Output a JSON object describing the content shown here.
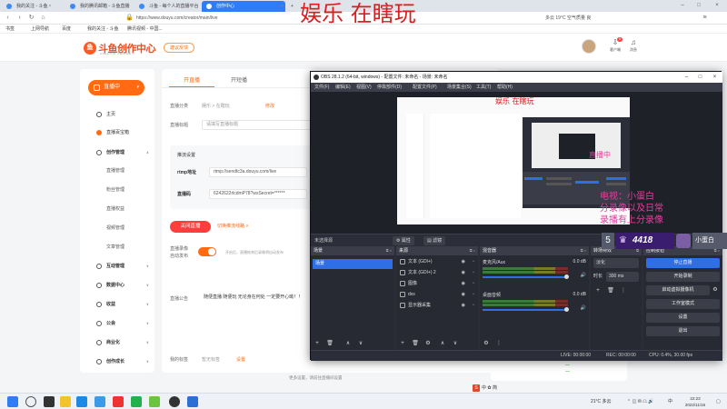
{
  "browser": {
    "tabs": [
      {
        "label": "我的关注 - 斗鱼"
      },
      {
        "label": "我的腾讯邮箱 - 斗鱼直播"
      },
      {
        "label": "斗鱼 - 每个人的直播平台"
      },
      {
        "label": "创作中心"
      }
    ],
    "url": "https://www.douyu.com/creator/main/live",
    "weather": "多云 19°C 空气质量 良",
    "favorites": [
      "书签",
      "上网导航",
      "百度",
      "我的关注 - 斗鱼",
      "腾讯视频 - 中国..."
    ],
    "overlay_title": "娱乐 在瞎玩"
  },
  "header": {
    "logo_text": "斗鱼创作中心",
    "logo_sub": "CREATOR CENTER",
    "pill": "建议反馈",
    "icons": [
      {
        "label": "客户端",
        "badge": "5"
      },
      {
        "label": "消息",
        "badge": ""
      }
    ]
  },
  "sidebar": {
    "live_button": "直播中",
    "items": [
      {
        "label": "主页",
        "caret": ""
      },
      {
        "label": "直播百宝箱",
        "caret": ""
      },
      {
        "label": "创作管理",
        "caret": "∧"
      },
      {
        "label": "互动管理",
        "caret": "∨"
      },
      {
        "label": "数据中心",
        "caret": "∨"
      },
      {
        "label": "收益",
        "caret": "∨"
      },
      {
        "label": "公会",
        "caret": "∨"
      },
      {
        "label": "商业化",
        "caret": "∨"
      },
      {
        "label": "创作成长",
        "caret": "∨"
      }
    ],
    "sub_items": [
      "直播管理",
      "粉丝管理",
      "直播权益",
      "视频管理",
      "文章管理"
    ]
  },
  "main": {
    "tabs": [
      "开直播",
      "开短播"
    ],
    "fields": {
      "category_label": "直播分类",
      "category_value": "娱乐 > 在瞎玩",
      "edit": "修改",
      "title_label": "直播标题",
      "title_value": "请填写直播标题",
      "push_title": "推流设置",
      "rtmp_label": "rtmp地址",
      "rtmp_value": "rtmp://sendtc3a.douyu.com/live",
      "code_label": "直播码",
      "code_value": "6242622rlcdmP78?wsSecret=******"
    },
    "close_live": "关闭直播",
    "switch_link": "切换推流线路 >",
    "record_label": "直播录像",
    "record_label2": "自动发布",
    "record_desc": "开启后，直播结束后录像将自动发布",
    "notice_label": "直播公告",
    "notice_text": "随便直播 随便玩 无论身在何处 一定要开心呦！！",
    "tags_label": "我的标签",
    "tags_value": "暂无标签",
    "tags_edit": "设置",
    "footer": "更多设置，请前往直播间设置",
    "right_numbers": [
      "—",
      "—"
    ]
  },
  "obs": {
    "title": "OBS 28.1.2 (64-bit, windows) - 配置文件: 未命名 - 场景: 未命名",
    "menu": [
      "文件(F)",
      "编辑(E)",
      "视图(V)",
      "停靠部件(D)",
      "配置文件(P)",
      "场景集合(S)",
      "工具(T)",
      "帮助(H)"
    ],
    "preview_overlay": "娱乐 在瞎玩",
    "scene_bar": {
      "no_source": "未选择源",
      "props": "属性",
      "filters": "滤镜"
    },
    "docks": {
      "scenes": {
        "title": "场景",
        "items": [
          "场景"
        ]
      },
      "sources": {
        "title": "来源",
        "items": [
          "文本 (GDI+)",
          "文本 (GDI+) 2",
          "图像",
          "dxs",
          "显示器采集"
        ]
      },
      "mixer": {
        "title": "混音器",
        "channels": [
          {
            "name": "麦克风/Aux",
            "db": "0.0 dB"
          },
          {
            "name": "桌面音频",
            "db": "0.0 dB"
          }
        ]
      },
      "transitions": {
        "title": "转场特效",
        "type": "淡化",
        "duration_label": "时长",
        "duration": "300 ms"
      },
      "controls": {
        "title": "控制按钮",
        "buttons": [
          "停止直播",
          "开始录制",
          "启动虚拟摄像机",
          "工作室模式",
          "设置",
          "退出"
        ]
      }
    },
    "status": {
      "live": "LIVE: 00:00:00",
      "rec": "REC: 00:00:00",
      "cpu": "CPU: 0.4%, 30.00 fps"
    }
  },
  "overlay": {
    "pink_top": "直播中",
    "pink_lines": [
      "电视：小蛋白",
      "分录像以及日常",
      "录播有上分录像"
    ],
    "badge_num": "5",
    "crown_num": "4418",
    "name": "小蛋白"
  },
  "tray": {
    "strip": "中 ✿ 简",
    "weather": "21°C 多云",
    "lang": "中",
    "time": "22:23",
    "date": "2022/11/16"
  }
}
